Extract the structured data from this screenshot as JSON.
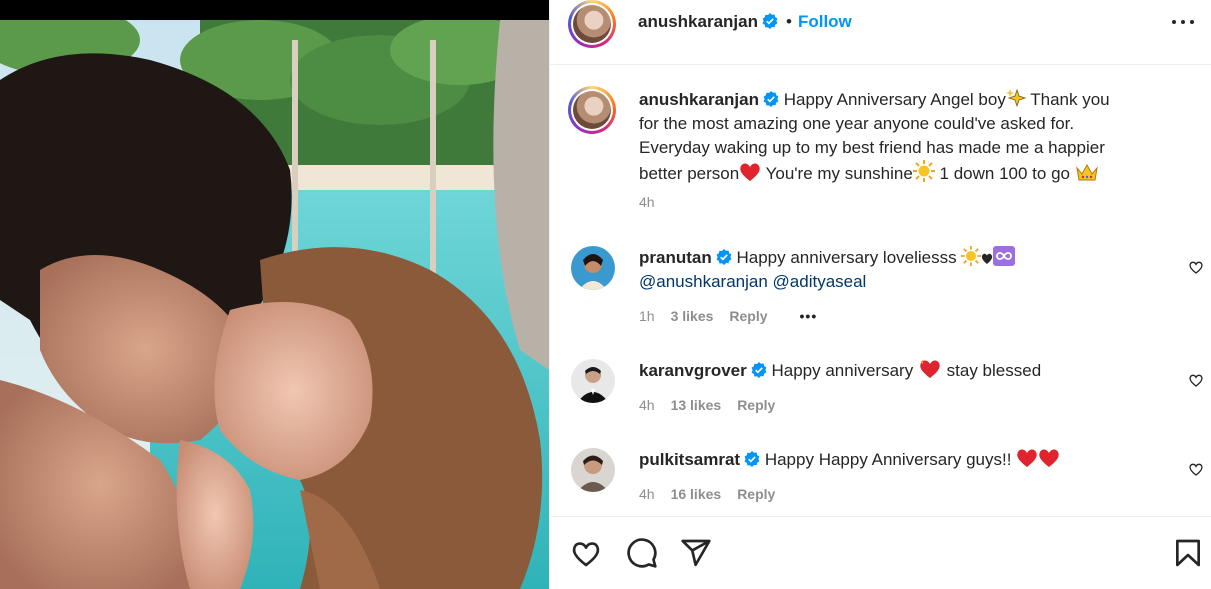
{
  "post": {
    "author": "anushkaranjan",
    "follow_label": "Follow",
    "separator": "•"
  },
  "caption": {
    "username": "anushkaranjan",
    "line1": "Happy Anniversary Angel boy",
    "line1b": " Thank you",
    "line2": "for the most amazing one year anyone could've asked for.",
    "line3": "Everyday waking up to my best friend has made me a happier",
    "line4a": "better person",
    "line4b": " You're my sunshine",
    "line4c": " 1 down 100 to go ",
    "time": "4h"
  },
  "comments": [
    {
      "username": "pranutan",
      "text": "Happy anniversary loveliesss ",
      "mention1": "@anushkaranjan",
      "mention2": "@adityaseal",
      "time": "1h",
      "likes": "3 likes",
      "reply": "Reply",
      "more": "•••"
    },
    {
      "username": "karanvgrover",
      "text": "Happy anniversary ",
      "text2": " stay blessed",
      "time": "4h",
      "likes": "13 likes",
      "reply": "Reply"
    },
    {
      "username": "pulkitsamrat",
      "text": "Happy Happy Anniversary guys!! ",
      "time": "4h",
      "likes": "16 likes",
      "reply": "Reply"
    }
  ],
  "icons": {
    "like": "heart-outline-icon",
    "comment": "comment-bubble-icon",
    "share": "paper-plane-icon",
    "save": "bookmark-icon",
    "verified": "verified-badge-icon",
    "more": "more-options-icon"
  },
  "colors": {
    "link": "#0095f6",
    "verified": "#0095f6",
    "muted": "#8e8e8e",
    "text": "#262626",
    "mention": "#00376b",
    "heart": "#e0245e"
  }
}
